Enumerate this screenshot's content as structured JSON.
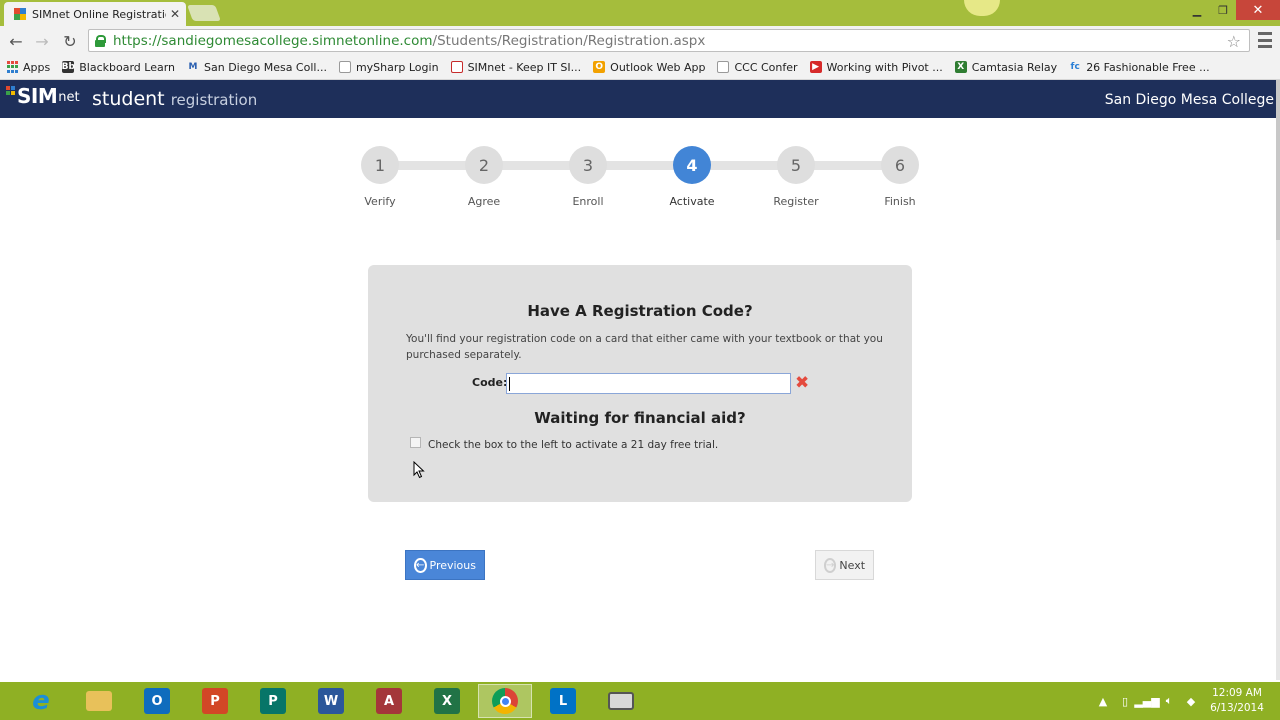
{
  "browser": {
    "tab_title": "SIMnet Online Registration",
    "url_secure": "https://sandiegomesacollege.simnetonline.com",
    "url_path": "/Students/Registration/Registration.aspx",
    "bookmarks": [
      {
        "label": "Apps",
        "icon": "apps-grid-icon",
        "color": "#e44b3e"
      },
      {
        "label": "Blackboard Learn",
        "icon": "blackboard-icon",
        "color": "#333333",
        "glyph": "Bb"
      },
      {
        "label": "San Diego Mesa Coll...",
        "icon": "mesa-m-icon",
        "color": "#2a5fb0",
        "glyph": "M"
      },
      {
        "label": "mySharp Login",
        "icon": "page-icon",
        "color": "#999999",
        "glyph": ""
      },
      {
        "label": "SIMnet - Keep IT SI...",
        "icon": "simnet-icon",
        "color": "#c62b2b",
        "glyph": ""
      },
      {
        "label": "Outlook Web App",
        "icon": "outlook-icon",
        "color": "#f2a100",
        "glyph": "O"
      },
      {
        "label": "CCC Confer",
        "icon": "page-icon",
        "color": "#999999",
        "glyph": ""
      },
      {
        "label": "Working with Pivot ...",
        "icon": "youtube-icon",
        "color": "#d62a2a",
        "glyph": "▶"
      },
      {
        "label": "Camtasia Relay",
        "icon": "camtasia-icon",
        "color": "#2f7d32",
        "glyph": "X"
      },
      {
        "label": "26 Fashionable Free ...",
        "icon": "fc-icon",
        "color": "#2a7fd6",
        "glyph": "fc"
      }
    ]
  },
  "header": {
    "logo_sim": "SIM",
    "logo_net": "net",
    "title_main": "student",
    "title_sub": "registration",
    "college": "San Diego Mesa College"
  },
  "steps": [
    {
      "number": "1",
      "label": "Verify",
      "active": false
    },
    {
      "number": "2",
      "label": "Agree",
      "active": false
    },
    {
      "number": "3",
      "label": "Enroll",
      "active": false
    },
    {
      "number": "4",
      "label": "Activate",
      "active": true
    },
    {
      "number": "5",
      "label": "Register",
      "active": false
    },
    {
      "number": "6",
      "label": "Finish",
      "active": false
    }
  ],
  "card": {
    "heading": "Have A Registration Code?",
    "description": "You'll find your registration code on a card that either came with your textbook or that you purchased separately.",
    "code_label": "Code:",
    "code_value": "",
    "financial_heading": "Waiting for financial aid?",
    "trial_label": "Check the box to the left to activate a 21 day free trial."
  },
  "buttons": {
    "previous": "Previous",
    "next": "Next"
  },
  "taskbar": {
    "items": [
      {
        "name": "internet-explorer-icon",
        "glyph": "e",
        "color": "#1c8fd8"
      },
      {
        "name": "file-explorer-icon",
        "glyph": "",
        "color": "#e8c15a"
      },
      {
        "name": "outlook-app-icon",
        "glyph": "O",
        "color": "#0f6cbd"
      },
      {
        "name": "powerpoint-icon",
        "glyph": "P",
        "color": "#d24726"
      },
      {
        "name": "publisher-icon",
        "glyph": "P",
        "color": "#077568"
      },
      {
        "name": "word-icon",
        "glyph": "W",
        "color": "#2b579a"
      },
      {
        "name": "access-icon",
        "glyph": "A",
        "color": "#a4373a"
      },
      {
        "name": "excel-icon",
        "glyph": "X",
        "color": "#217346"
      },
      {
        "name": "chrome-icon",
        "glyph": "",
        "color": "#ffffff"
      },
      {
        "name": "lync-icon",
        "glyph": "L",
        "color": "#0072c6"
      },
      {
        "name": "camtasia-recorder-icon",
        "glyph": "",
        "color": "#555555"
      }
    ],
    "time": "12:09 AM",
    "date": "6/13/2014"
  }
}
